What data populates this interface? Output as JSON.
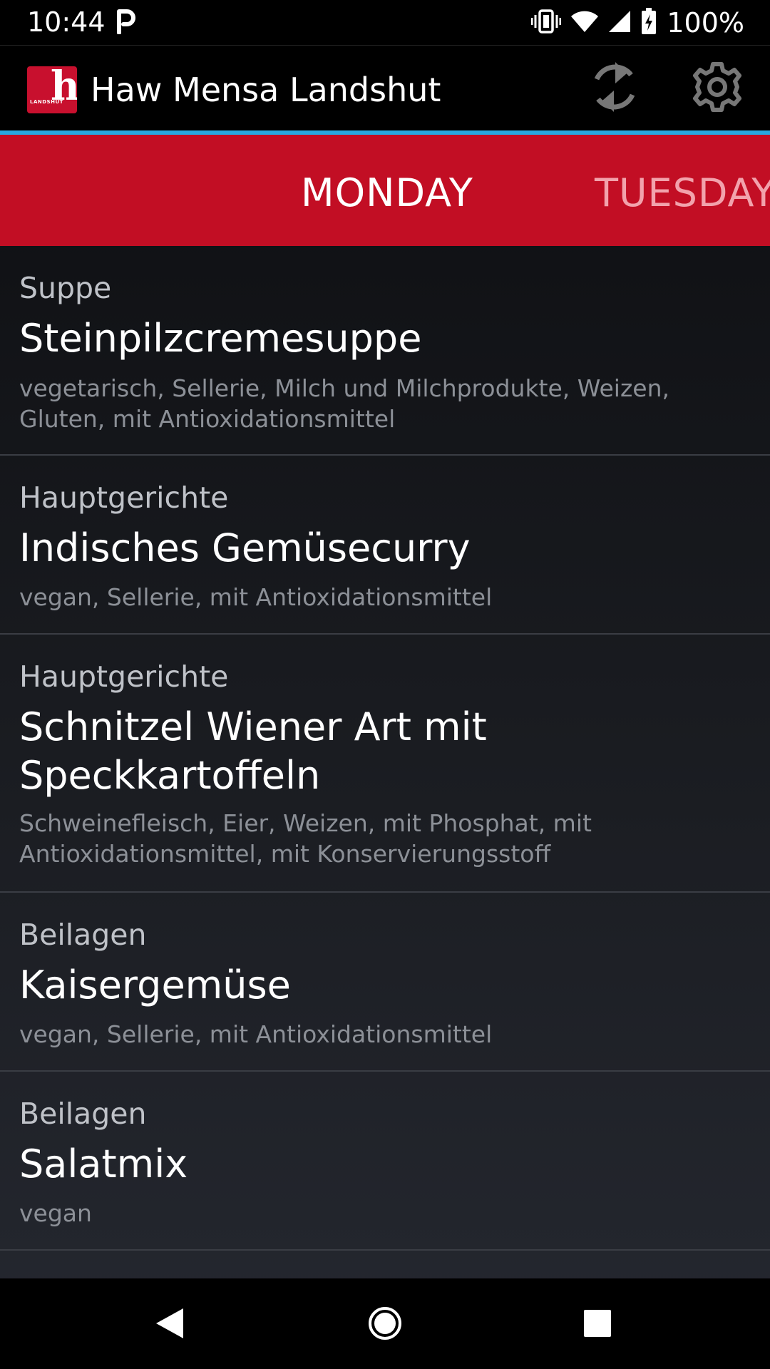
{
  "status_bar": {
    "time": "10:44",
    "battery": "100%"
  },
  "app_bar": {
    "title": "Haw Mensa Landshut",
    "logo_letter": "h",
    "logo_text": "LANDSHUT"
  },
  "tabs": [
    {
      "label": "MONDAY",
      "selected": true
    },
    {
      "label": "TUESDAY",
      "selected": false
    }
  ],
  "menu": [
    {
      "category": "Suppe",
      "dish": "Steinpilzcremesuppe",
      "info": "vegetarisch, Sellerie, Milch und Milchprodukte, Weizen, Gluten, mit Antioxidationsmittel"
    },
    {
      "category": "Hauptgerichte",
      "dish": "Indisches Gemüsecurry",
      "info": "vegan, Sellerie, mit Antioxidationsmittel"
    },
    {
      "category": "Hauptgerichte",
      "dish": "Schnitzel Wiener Art mit Speckkartoffeln",
      "info": "Schweinefleisch, Eier, Weizen, mit Phosphat, mit Antioxidationsmittel, mit Konservierungsstoff"
    },
    {
      "category": "Beilagen",
      "dish": "Kaisergemüse",
      "info": "vegan, Sellerie, mit Antioxidationsmittel"
    },
    {
      "category": "Beilagen",
      "dish": "Salatmix",
      "info": "vegan"
    }
  ],
  "colors": {
    "tab_bar": "#c20e24",
    "accent_line": "#27a9e1",
    "logo": "#c8102e"
  },
  "icons": {
    "refresh": "refresh-icon",
    "settings": "gear-icon",
    "back": "back-triangle-icon",
    "home": "home-circle-icon",
    "recents": "recents-square-icon"
  }
}
